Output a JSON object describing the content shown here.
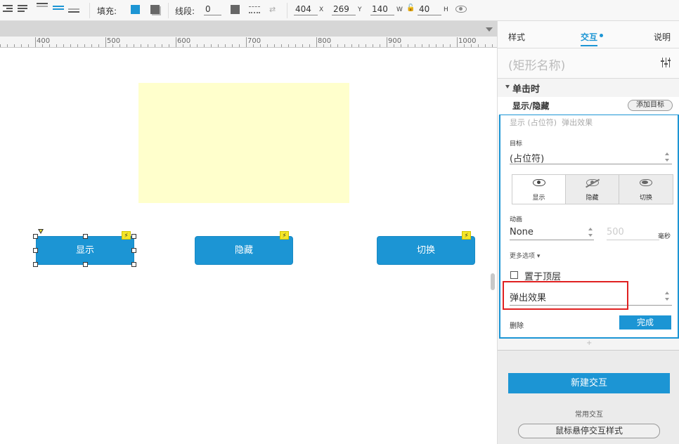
{
  "toolbar": {
    "fill_label": "填充:",
    "stroke_label": "线段:",
    "stroke_value": "0",
    "x_value": "404",
    "x_label": "X",
    "y_value": "269",
    "y_label": "Y",
    "w_value": "140",
    "w_label": "W",
    "h_value": "40",
    "h_label": "H",
    "fill_color": "#1c95d4"
  },
  "ruler": {
    "labels": [
      "400",
      "500",
      "600",
      "700",
      "800",
      "900",
      "1000"
    ]
  },
  "canvas": {
    "buttons": [
      {
        "label": "显示"
      },
      {
        "label": "隐藏"
      },
      {
        "label": "切换"
      }
    ],
    "lightning_icon": "⚡"
  },
  "panel": {
    "tabs": [
      "样式",
      "交互",
      "说明"
    ],
    "active_tab": "交互",
    "shape_name_placeholder": "(矩形名称)",
    "event_title": "单击时",
    "action_title": "显示/隐藏",
    "add_target_label": "添加目标",
    "summary": "显示 (占位符)  弹出效果",
    "target_label": "目标",
    "target_value": "(占位符)",
    "visibility": [
      "显示",
      "隐藏",
      "切换"
    ],
    "animation_label": "动画",
    "animation_value": "None",
    "duration_value": "500",
    "duration_unit": "毫秒",
    "more_options_label": "更多选项 ▾",
    "bring_to_front_label": "置于顶层",
    "effect_value": "弹出效果",
    "delete_label": "删除",
    "done_label": "完成",
    "plus_symbol": "+",
    "new_interaction_label": "新建交互",
    "common_label": "常用交互",
    "hover_style_label": "鼠标悬停交互样式"
  },
  "colors": {
    "accent": "#1c95d4",
    "placeholder_fill": "#ffffcc",
    "highlight_red": "#e02020"
  }
}
